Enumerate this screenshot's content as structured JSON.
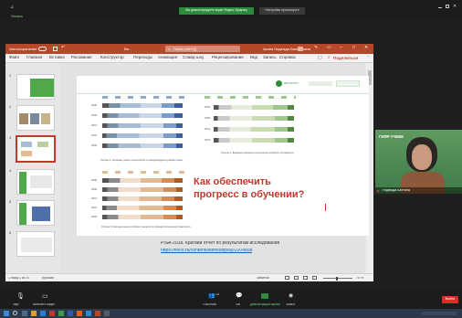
{
  "meet": {
    "sharing_banner": "Вы демонстрируете экран Яндекс Браузер",
    "sharing_settings": "Настройки просмотра ▾",
    "top_left_label": "Запись",
    "bottom": {
      "mic_label": "Звук",
      "vid_label": "Включить видео",
      "participants_label": "Участники",
      "participants_count": "25",
      "chat_label": "Чат",
      "share_label": "Демонстрация экрана",
      "record_label": "Запись",
      "end_label": "Выйти"
    },
    "video_tile": {
      "logo_text": "ГИФР УЧЕБЕ",
      "name": "Надежда Бахтина"
    }
  },
  "ppt": {
    "autosave_label": "Автосохранение",
    "search_placeholder": "Поиск (Alt+Q)",
    "user_name": "Акаев Надежда Викторовна",
    "tabs": [
      "Файл",
      "Главная",
      "Вставка",
      "Рисование",
      "Конструктор",
      "Переходы",
      "Анимация",
      "Слайд-шоу",
      "Рецензирование",
      "Вид",
      "Запись",
      "Справка"
    ],
    "share_label": "Поделиться",
    "status_left": "Слайд 3 из 19",
    "status_lang": "русский",
    "status_notes": "Заметки",
    "zoom": "74 %",
    "thumb_numbers": [
      "1",
      "2",
      "3",
      "4",
      "5",
      "6"
    ]
  },
  "slide": {
    "headline": "Как обеспечить прогресс в обучении?",
    "caption1": "Рисунок 1. Основные уровни чтения России по международным уровням чтения",
    "caption2": "Рисунок 2. Динамика показателя результатов российских обучающихся",
    "caption3": "Рисунок 3. Распределение российских учащихся по уровням читательской грамотности",
    "source_line1": "PISA-2018. Краткий отчет по результатам исследования",
    "source_line2": "https://fioco.ru/contents/item/display/2204808",
    "logo_text": "ИНСТИТУТ",
    "chart_rows_left": [
      "2000",
      "2009",
      "2012",
      "2015",
      "2018"
    ],
    "chart_rows_right": [
      "2000",
      "2009",
      "2012",
      "2015"
    ],
    "chart_rows_bottom": [
      "2000",
      "2009",
      "2012",
      "2015",
      "2018"
    ]
  },
  "colors": {
    "ppt_red": "#b7472a",
    "meet_green": "#2d8c3c",
    "slide_green": "#2e8b3a",
    "headline_red": "#c0392b"
  }
}
